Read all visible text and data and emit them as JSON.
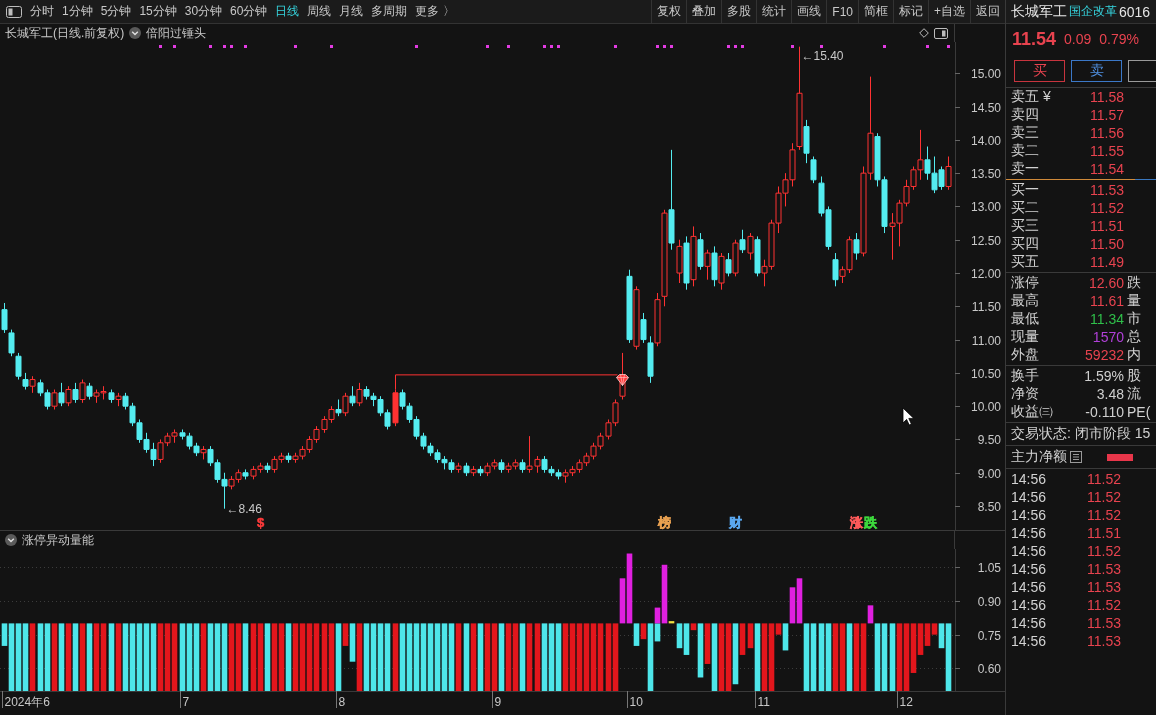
{
  "toolbar": {
    "periods": [
      {
        "label": "分时",
        "selected": false
      },
      {
        "label": "1分钟",
        "selected": false
      },
      {
        "label": "5分钟",
        "selected": false
      },
      {
        "label": "15分钟",
        "selected": false
      },
      {
        "label": "30分钟",
        "selected": false
      },
      {
        "label": "60分钟",
        "selected": false
      },
      {
        "label": "日线",
        "selected": true
      },
      {
        "label": "周线",
        "selected": false
      },
      {
        "label": "月线",
        "selected": false
      },
      {
        "label": "多周期",
        "selected": false
      },
      {
        "label": "更多 〉",
        "selected": false
      }
    ],
    "actions": [
      "复权",
      "叠加",
      "多股",
      "统计",
      "画线",
      "F10",
      "简框",
      "标记",
      "+自选",
      "返回"
    ]
  },
  "price_chart": {
    "title": "长城军工(日线.前复权)",
    "indicator": "倍阳过锤头",
    "price_labels": [
      "←15.40",
      "←8.46"
    ],
    "event_tags": [
      {
        "label": "$",
        "color": "#ff3b3b"
      },
      {
        "label": "榜",
        "color": "#e8a050"
      },
      {
        "label": "财",
        "color": "#5aa8f0"
      },
      {
        "label": "涨",
        "color": "#ff5a5a"
      },
      {
        "label": "跌",
        "color": "#3cd83c"
      }
    ],
    "y_axis": [
      "15.00",
      "14.50",
      "14.00",
      "13.50",
      "13.00",
      "12.50",
      "12.00",
      "11.50",
      "11.00",
      "10.50",
      "10.00",
      "9.50",
      "9.00",
      "8.50"
    ]
  },
  "volume_indicator": {
    "title": "涨停异动量能",
    "y_axis": [
      "1.05",
      "0.90",
      "0.75",
      "0.60"
    ]
  },
  "time_axis": [
    "2024年6",
    "7",
    "8",
    "9",
    "10",
    "11",
    "12"
  ],
  "quote_panel": {
    "name": "长城军工",
    "concept": "国企改革",
    "code": "6016",
    "price": "11.54",
    "change": "0.09",
    "change_pct": "0.79%",
    "trade_buttons": [
      {
        "label": "买",
        "kind": "buy"
      },
      {
        "label": "卖",
        "kind": "sell"
      },
      {
        "kind": "more"
      }
    ],
    "asks": [
      {
        "label": "卖五 ¥",
        "price": "11.58"
      },
      {
        "label": "卖四",
        "price": "11.57"
      },
      {
        "label": "卖三",
        "price": "11.56"
      },
      {
        "label": "卖二",
        "price": "11.55"
      },
      {
        "label": "卖一",
        "price": "11.54"
      }
    ],
    "bids": [
      {
        "label": "买一",
        "price": "11.53"
      },
      {
        "label": "买二",
        "price": "11.52"
      },
      {
        "label": "买三",
        "price": "11.51"
      },
      {
        "label": "买四",
        "price": "11.50"
      },
      {
        "label": "买五",
        "price": "11.49"
      }
    ],
    "stat_groups": [
      {
        "rows": [
          {
            "label": "涨停",
            "value": "12.60",
            "color": "#e8434f",
            "column_3": "跌"
          },
          {
            "label": "最高",
            "value": "11.61",
            "color": "#e8434f",
            "column_3": "量"
          },
          {
            "label": "最低",
            "value": "11.34",
            "color": "#2fbf4a",
            "column_3": "市"
          },
          {
            "label": "现量",
            "value": "1570",
            "color": "#b040d8",
            "column_3": "总"
          },
          {
            "label": "外盘",
            "value": "59232",
            "color": "#e8434f",
            "column_3": "内"
          }
        ]
      },
      {
        "rows": [
          {
            "label": "换手",
            "value": "1.59%",
            "color": "#cfcfcf",
            "column_3": "股"
          },
          {
            "label": "净资",
            "value": "3.48",
            "color": "#cfcfcf",
            "column_3": "流"
          },
          {
            "label": "收益㈢",
            "value": "-0.110",
            "color": "#cfcfcf",
            "column_3": "PE("
          }
        ]
      }
    ],
    "status": "交易状态: 闭市阶段 15",
    "net_flow": {
      "label": "主力净额"
    },
    "ticks": [
      {
        "time": "14:56",
        "price": "11.52"
      },
      {
        "time": "14:56",
        "price": "11.52"
      },
      {
        "time": "14:56",
        "price": "11.52"
      },
      {
        "time": "14:56",
        "price": "11.51"
      },
      {
        "time": "14:56",
        "price": "11.52"
      },
      {
        "time": "14:56",
        "price": "11.53"
      },
      {
        "time": "14:56",
        "price": "11.53"
      },
      {
        "time": "14:56",
        "price": "11.52"
      },
      {
        "time": "14:56",
        "price": "11.53"
      },
      {
        "time": "14:56",
        "price": "11.53"
      }
    ]
  }
}
